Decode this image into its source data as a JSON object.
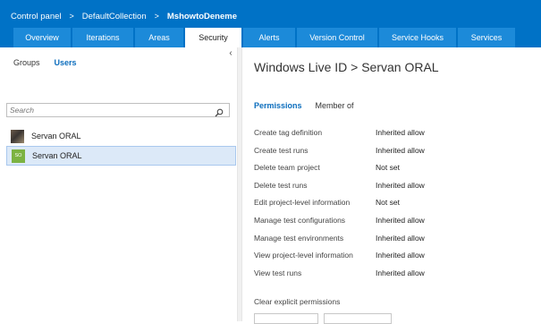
{
  "breadcrumb": {
    "items": [
      "Control panel",
      "DefaultCollection",
      "MshowtoDeneme"
    ],
    "separator": ">"
  },
  "tabs": [
    {
      "label": "Overview",
      "active": false
    },
    {
      "label": "Iterations",
      "active": false
    },
    {
      "label": "Areas",
      "active": false
    },
    {
      "label": "Security",
      "active": true
    },
    {
      "label": "Alerts",
      "active": false
    },
    {
      "label": "Version Control",
      "active": false
    },
    {
      "label": "Service Hooks",
      "active": false
    },
    {
      "label": "Services",
      "active": false
    }
  ],
  "left": {
    "subtabs": [
      {
        "label": "Groups",
        "active": false
      },
      {
        "label": "Users",
        "active": true
      }
    ],
    "search": {
      "placeholder": "Search",
      "value": ""
    },
    "users": [
      {
        "name": "Servan ORAL",
        "avatar": "photo",
        "selected": false
      },
      {
        "name": "Servan ORAL",
        "avatar": "SO",
        "selected": true
      }
    ]
  },
  "right": {
    "identity_title": "Windows Live ID > Servan ORAL",
    "tabs": [
      {
        "label": "Permissions",
        "active": true
      },
      {
        "label": "Member of",
        "active": false
      }
    ],
    "permissions": [
      {
        "name": "Create tag definition",
        "value": "Inherited allow"
      },
      {
        "name": "Create test runs",
        "value": "Inherited allow"
      },
      {
        "name": "Delete team project",
        "value": "Not set"
      },
      {
        "name": "Delete test runs",
        "value": "Inherited allow"
      },
      {
        "name": "Edit project-level information",
        "value": "Not set"
      },
      {
        "name": "Manage test configurations",
        "value": "Inherited allow"
      },
      {
        "name": "Manage test environments",
        "value": "Inherited allow"
      },
      {
        "name": "View project-level information",
        "value": "Inherited allow"
      },
      {
        "name": "View test runs",
        "value": "Inherited allow"
      }
    ],
    "clear_label": "Clear explicit permissions"
  },
  "colors": {
    "header_bg": "#0072c6",
    "tab_bg": "#1c8ad9",
    "accent": "#0b6dbd",
    "selection_bg": "#dce9f8"
  }
}
